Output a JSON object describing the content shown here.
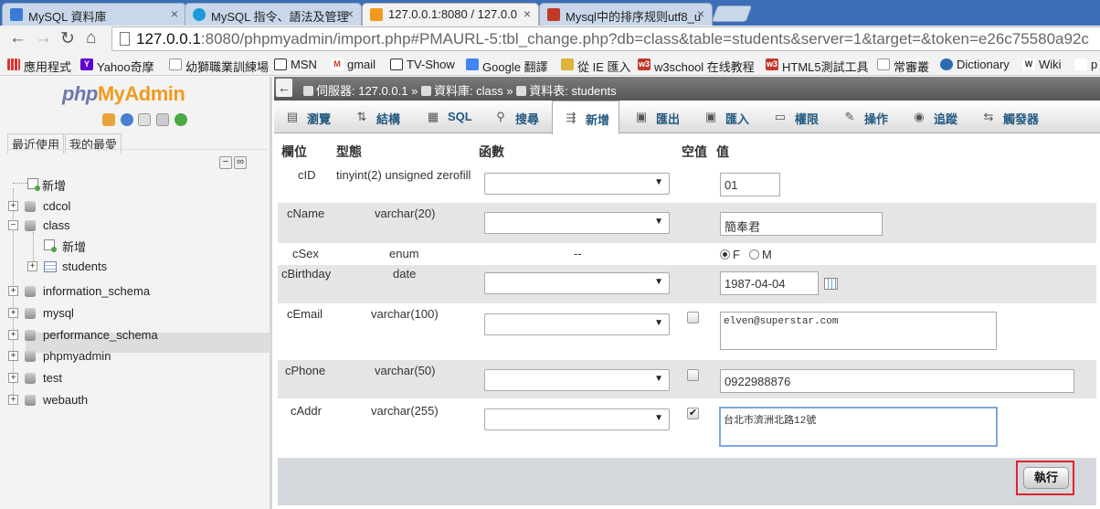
{
  "browser": {
    "tabs": [
      {
        "title": "MySQL 資料庫",
        "favicon_color": "#3a7bd5"
      },
      {
        "title": "MySQL 指令、語法及管理",
        "favicon_color": "#1a9bd7"
      },
      {
        "title": "127.0.0.1:8080 / 127.0.0",
        "favicon_color": "#f29a1f"
      },
      {
        "title": "Mysql中的排序规则utf8_u",
        "favicon_color": "#c0392b"
      }
    ],
    "close_glyph": "×",
    "nav": {
      "back": "←",
      "forward": "→",
      "reload": "↻",
      "home": "⌂"
    },
    "url_host": "127.0.0.1",
    "url_path": ":8080/phpmyadmin/import.php#PMAURL-5:tbl_change.php?db=class&table=students&server=1&target=&token=e26c75580a92c",
    "bookmarks": [
      {
        "label": "應用程式",
        "icon_color": "#d33"
      },
      {
        "label": "Yahoo奇摩",
        "icon_color": "#5f01d1"
      },
      {
        "label": "幼獅職業訓練場",
        "icon_color": "#999"
      },
      {
        "label": "MSN",
        "icon_color": "#333"
      },
      {
        "label": "gmail",
        "icon_color": "#d93025"
      },
      {
        "label": "TV-Show",
        "icon_color": "#333"
      },
      {
        "label": "Google 翻譯",
        "icon_color": "#4285f4"
      },
      {
        "label": "從 IE 匯入",
        "icon_color": "#e0b33c"
      },
      {
        "label": "w3school 在线教程",
        "icon_color": "#c0392b"
      },
      {
        "label": "HTML5測試工具",
        "icon_color": "#c0392b"
      },
      {
        "label": "常審叢",
        "icon_color": "#999"
      },
      {
        "label": "Dictionary",
        "icon_color": "#2b6cb0"
      },
      {
        "label": "Wiki",
        "icon_color": "#333"
      },
      {
        "label": "p",
        "icon_color": "#c0392b"
      }
    ],
    "bookmark_icon_glyphs": {
      "yahoo": "Y",
      "gmail": "M",
      "w3": "w3",
      "wiki": "W"
    }
  },
  "sidebar": {
    "logo_php": "php",
    "logo_myadmin": "MyAdmin",
    "link_tabs": [
      "最近使用",
      "我的最愛"
    ],
    "collapse_glyph": "−",
    "link_glyph": "∞",
    "new_label": "新增",
    "databases": [
      "cdcol",
      "class",
      "information_schema",
      "mysql",
      "performance_schema",
      "phpmyadmin",
      "test",
      "webauth"
    ],
    "class_new_label": "新增",
    "class_table": "students",
    "plus": "+",
    "minus": "−"
  },
  "breadcrumb": {
    "back_glyph": "←",
    "server_label": "伺服器: 127.0.0.1",
    "sep1": "»",
    "db_label": "資料庫: class",
    "sep2": "»",
    "table_label": "資料表: students"
  },
  "menu": {
    "tabs": [
      {
        "label": "瀏覽",
        "icon": "browse-icon",
        "glyph": "▤"
      },
      {
        "label": "結構",
        "icon": "structure-icon",
        "glyph": "⇅"
      },
      {
        "label": "SQL",
        "icon": "sql-icon",
        "glyph": "▦"
      },
      {
        "label": "搜尋",
        "icon": "search-icon",
        "glyph": "⚲"
      },
      {
        "label": "新增",
        "icon": "insert-icon",
        "glyph": "⇶"
      },
      {
        "label": "匯出",
        "icon": "export-icon",
        "glyph": "▣"
      },
      {
        "label": "匯入",
        "icon": "import-icon",
        "glyph": "▣"
      },
      {
        "label": "權限",
        "icon": "privileges-icon",
        "glyph": "▭"
      },
      {
        "label": "操作",
        "icon": "operations-icon",
        "glyph": "✎"
      },
      {
        "label": "追蹤",
        "icon": "tracking-icon",
        "glyph": "◉"
      },
      {
        "label": "觸發器",
        "icon": "triggers-icon",
        "glyph": "⇆"
      }
    ]
  },
  "form": {
    "headers": {
      "column": "欄位",
      "type": "型態",
      "function": "函數",
      "null": "空值",
      "value": "值"
    },
    "select_arrow": "▼",
    "check_glyph": "✔",
    "rows": [
      {
        "name": "cID",
        "type": "tinyint(2) unsigned zerofill",
        "value": "01"
      },
      {
        "name": "cName",
        "type": "varchar(20)",
        "value": "簡奉君"
      },
      {
        "name": "cSex",
        "type": "enum",
        "function": "--",
        "radio_options": [
          "F",
          "M"
        ],
        "selected": "F"
      },
      {
        "name": "cBirthday",
        "type": "date",
        "value": "1987-04-04"
      },
      {
        "name": "cEmail",
        "type": "varchar(100)",
        "null_checked": false,
        "value": "elven@superstar.com"
      },
      {
        "name": "cPhone",
        "type": "varchar(50)",
        "null_checked": false,
        "value": "0922988876"
      },
      {
        "name": "cAddr",
        "type": "varchar(255)",
        "null_checked": true,
        "value": "台北市濟洲北路12號"
      }
    ],
    "execute_label": "執行"
  }
}
